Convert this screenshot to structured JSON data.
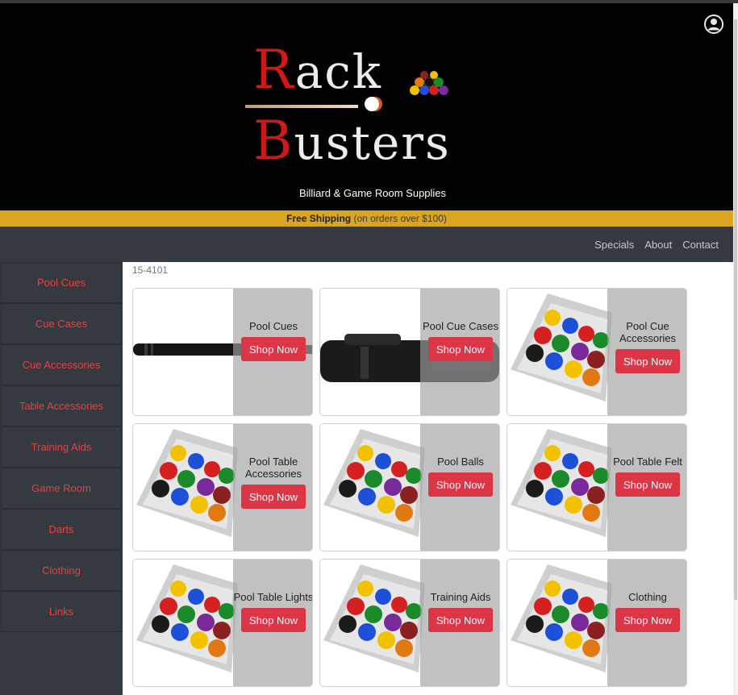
{
  "header": {
    "logo_line1": "Rack",
    "logo_line2": "Busters",
    "tagline": "Billiard & Game Room Supplies",
    "user_icon": "user-circle-icon"
  },
  "shipping": {
    "strong": "Free Shipping",
    "note": "(on orders over $100)"
  },
  "nav": {
    "items": [
      "Specials",
      "About",
      "Contact"
    ]
  },
  "sidebar": {
    "items": [
      {
        "label": "Pool Cues"
      },
      {
        "label": "Cue Cases"
      },
      {
        "label": "Cue Accessories"
      },
      {
        "label": "Table Accessories"
      },
      {
        "label": "Training Aids"
      },
      {
        "label": "Game Room"
      },
      {
        "label": "Darts"
      },
      {
        "label": "Clothing"
      },
      {
        "label": "Links"
      }
    ]
  },
  "main": {
    "sku": "15-4101",
    "shop_label": "Shop Now",
    "cards": [
      {
        "title": "Pool Cues",
        "image": "pool-cue"
      },
      {
        "title": "Pool Cue Cases",
        "image": "cue-case"
      },
      {
        "title": "Pool Cue Accessories",
        "image": "ball-set"
      },
      {
        "title": "Pool Table Accessories",
        "image": "ball-set"
      },
      {
        "title": "Pool Balls",
        "image": "ball-set"
      },
      {
        "title": "Pool Table Felt",
        "image": "ball-set"
      },
      {
        "title": "Pool Table Lights",
        "image": "ball-set"
      },
      {
        "title": "Training Aids",
        "image": "ball-set"
      },
      {
        "title": "Clothing",
        "image": "ball-set"
      }
    ]
  },
  "colors": {
    "accent": "#dc3545",
    "shipping_bar": "#daa520",
    "nav_bg": "#343a40",
    "sidebar_text": "#e8403f"
  }
}
